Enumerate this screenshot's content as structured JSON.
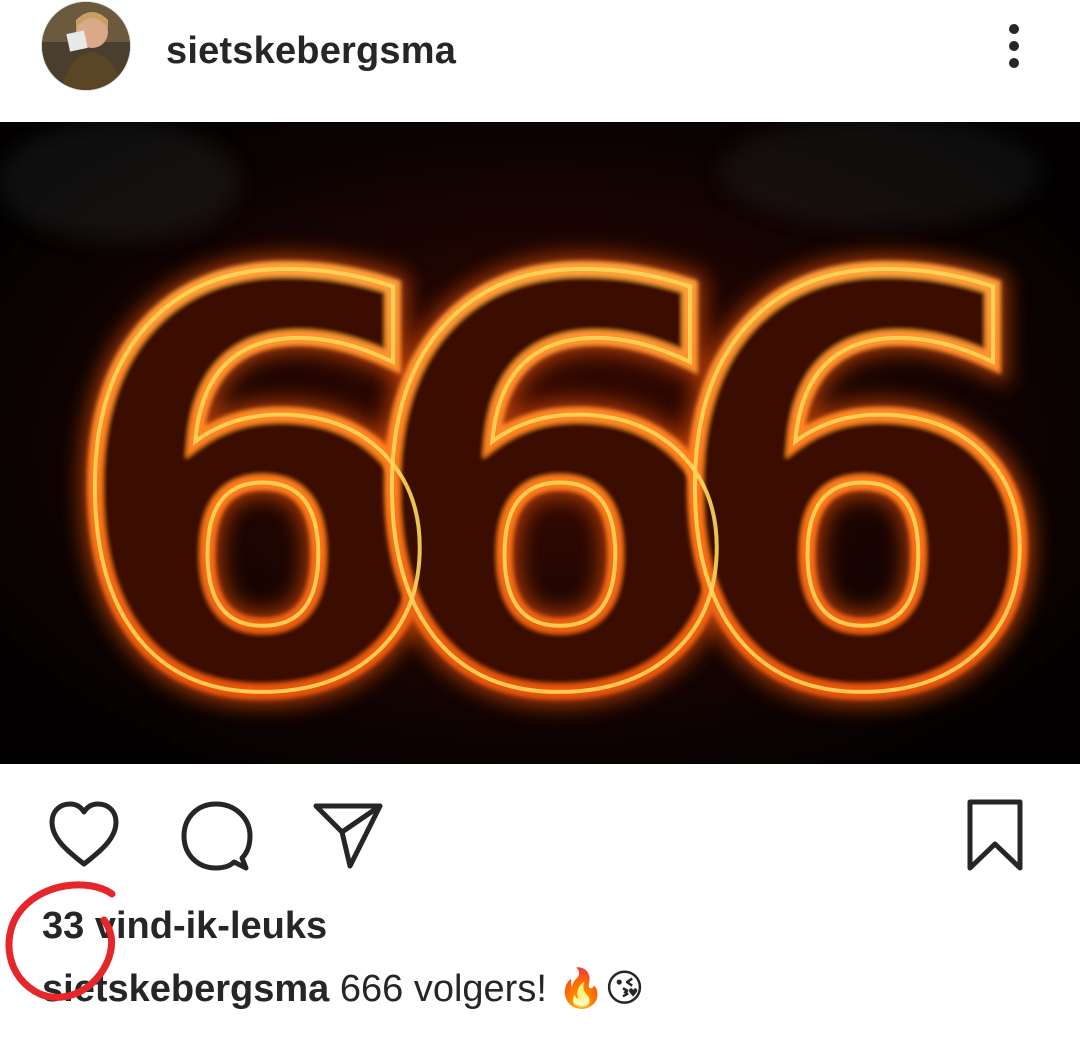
{
  "header": {
    "username": "sietskebergsma",
    "more_icon": "more-vertical-icon"
  },
  "post": {
    "image_text": "666",
    "icons": {
      "like": "heart-icon",
      "comment": "comment-icon",
      "share": "send-icon",
      "save": "bookmark-icon"
    },
    "likes_text": "33 vind-ik-leuks",
    "caption": {
      "username": "sietskebergsma",
      "text": "666 volgers!",
      "emojis": "🔥😘"
    }
  },
  "colors": {
    "text": "#262626",
    "annotation": "#e5262b",
    "flame_orange": "#ff8a1c",
    "flame_yellow": "#ffd75a"
  }
}
